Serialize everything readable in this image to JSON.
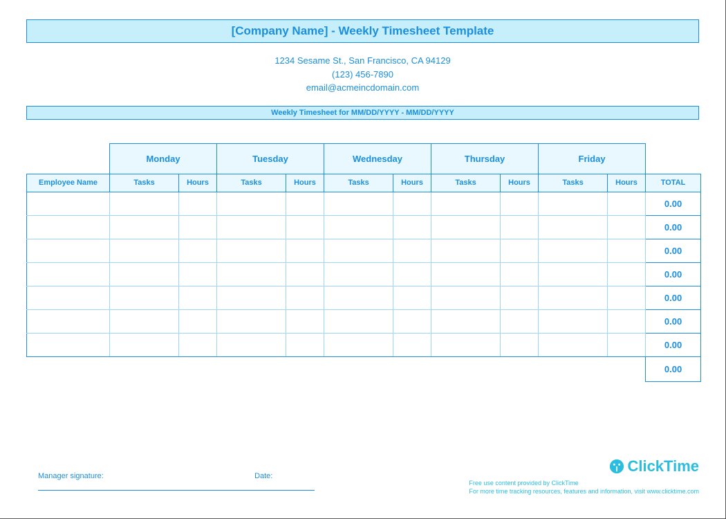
{
  "header": {
    "title": "[Company Name] - Weekly Timesheet Template",
    "address": "1234 Sesame St.,  San Francisco, CA 94129",
    "phone": "(123) 456-7890",
    "email": "email@acmeincdomain.com",
    "subtitle": "Weekly Timesheet for MM/DD/YYYY - MM/DD/YYYY"
  },
  "columns": {
    "employee": "Employee Name",
    "days": [
      "Monday",
      "Tuesday",
      "Wednesday",
      "Thursday",
      "Friday"
    ],
    "tasks": "Tasks",
    "hours": "Hours",
    "total": "TOTAL"
  },
  "rows": [
    {
      "total": "0.00"
    },
    {
      "total": "0.00"
    },
    {
      "total": "0.00"
    },
    {
      "total": "0.00"
    },
    {
      "total": "0.00"
    },
    {
      "total": "0.00"
    },
    {
      "total": "0.00"
    }
  ],
  "grand_total": "0.00",
  "footer": {
    "signature_label": "Manager signature:",
    "date_label": "Date:",
    "brand": "ClickTime",
    "brand_line1": "Free use content provided by ClickTime",
    "brand_line2": "For more time tracking resources, features and information, visit www.clicktime.com"
  }
}
